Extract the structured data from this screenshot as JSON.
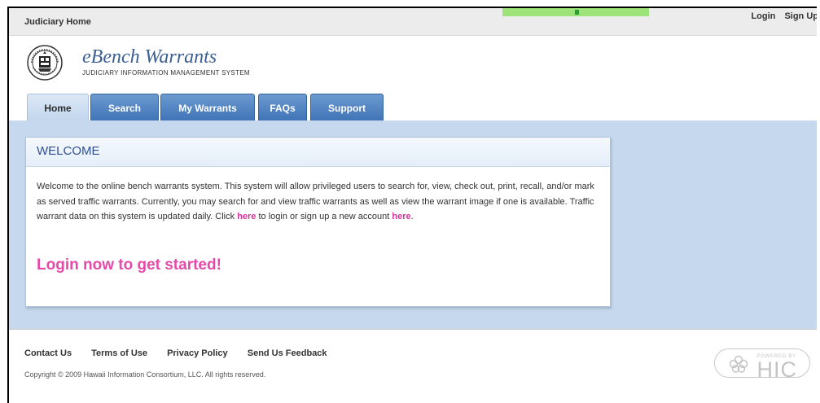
{
  "topbar": {
    "home_label": "Judiciary Home",
    "login_label": "Login",
    "signup_label": "Sign Up"
  },
  "header": {
    "title": "eBench Warrants",
    "subtitle": "JUDICIARY INFORMATION MANAGEMENT SYSTEM",
    "seal_icon": "state-seal-icon"
  },
  "tabs": [
    {
      "label": "Home",
      "active": true
    },
    {
      "label": "Search",
      "active": false
    },
    {
      "label": "My Warrants",
      "active": false
    },
    {
      "label": "FAQs",
      "active": false
    },
    {
      "label": "Support",
      "active": false
    }
  ],
  "welcome": {
    "heading": "WELCOME",
    "body_part1": "Welcome to the online bench warrants system. This system will allow privileged users to search for, view, check out, print, recall, and/or mark as served traffic warrants. Currently, you may search for and view traffic warrants as well as view the warrant image if one is available. Traffic warrant data on this system is updated daily. Click ",
    "link1": "here",
    "body_part2": " to login or sign up a new account ",
    "link2": "here",
    "body_part3": ".",
    "cta": "Login now to get started!"
  },
  "footer": {
    "links": [
      "Contact Us",
      "Terms of Use",
      "Privacy Policy",
      "Send Us Feedback"
    ],
    "copyright": "Copyright © 2009 Hawaii Information Consortium, LLC. All rights reserved.",
    "badge_powered": "POWERED BY",
    "badge_name": "HIC"
  },
  "colors": {
    "tab_blue": "#4a7ebf",
    "content_bg": "#c5d8ee",
    "link_pink": "#d6339a",
    "title_blue": "#3b5f95"
  }
}
